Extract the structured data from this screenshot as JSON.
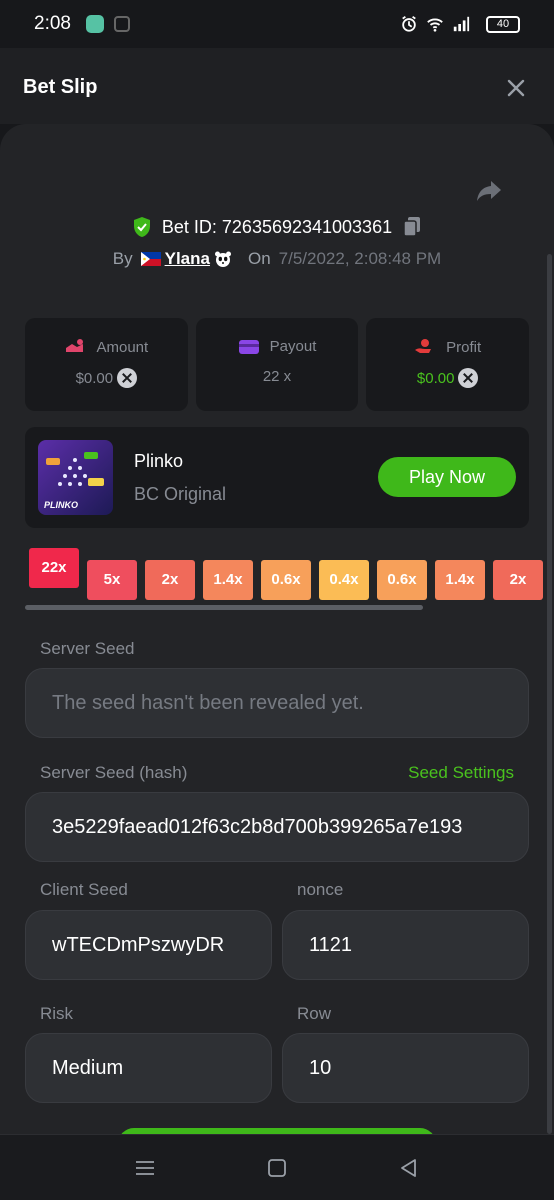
{
  "status_bar": {
    "time": "2:08",
    "battery": "40",
    "icons": [
      "app-icon",
      "alarm-icon",
      "wifi-icon",
      "signal-icon",
      "battery-icon"
    ]
  },
  "header": {
    "title": "Bet Slip",
    "close_icon": "close-icon"
  },
  "bet": {
    "id_text": "Bet ID: 72635692341003361",
    "by_label": "By",
    "user": "Ylana",
    "on_label": "On",
    "datetime": "7/5/2022, 2:08:48 PM"
  },
  "stats": {
    "amount": {
      "label": "Amount",
      "value": "$0.00"
    },
    "payout": {
      "label": "Payout",
      "value": "22 x"
    },
    "profit": {
      "label": "Profit",
      "value": "$0.00"
    }
  },
  "game": {
    "name": "Plinko",
    "subtitle": "BC Original",
    "thumb_label": "PLINKO",
    "play_button": "Play Now"
  },
  "multipliers": [
    "22x",
    "5x",
    "2x",
    "1.4x",
    "0.6x",
    "0.4x",
    "0.6x",
    "1.4x",
    "2x"
  ],
  "multiplier_colors": [
    "#f0284b",
    "#ef4e5e",
    "#f06a5a",
    "#f4875c",
    "#f7a05a",
    "#fbbc55",
    "#f7a05a",
    "#f4875c",
    "#f06a5a"
  ],
  "form": {
    "server_seed_label": "Server Seed",
    "server_seed_placeholder": "The seed hasn't been revealed yet.",
    "server_seed_hash_label": "Server Seed (hash)",
    "seed_settings": "Seed Settings",
    "server_seed_hash": "3e5229faead012f63c2b8d700b399265a7e193",
    "client_seed_label": "Client Seed",
    "client_seed": "wTECDmPszwyDR",
    "nonce_label": "nonce",
    "nonce": "1121",
    "risk_label": "Risk",
    "risk": "Medium",
    "row_label": "Row",
    "row": "10"
  },
  "colors": {
    "accent_green": "#3fb81a",
    "profit_green": "#4ac21e",
    "background": "#232427"
  }
}
